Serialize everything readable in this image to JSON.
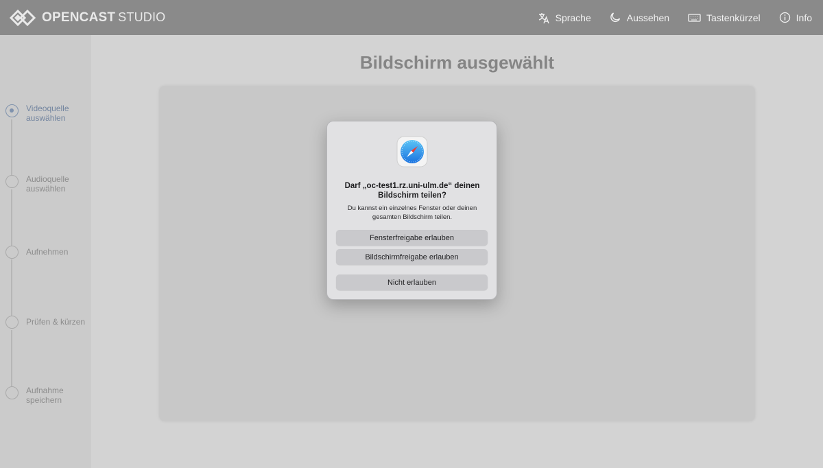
{
  "header": {
    "logo_bold": "OPENCAST",
    "logo_light": "STUDIO",
    "nav": {
      "language": "Sprache",
      "appearance": "Aussehen",
      "shortcuts": "Tastenkürzel",
      "info": "Info"
    }
  },
  "sidebar": {
    "steps": [
      {
        "label": "Videoquelle auswählen",
        "active": true
      },
      {
        "label": "Audioquelle auswählen",
        "active": false
      },
      {
        "label": "Aufnehmen",
        "active": false
      },
      {
        "label": "Prüfen & kürzen",
        "active": false
      },
      {
        "label": "Aufnahme speichern",
        "active": false
      }
    ]
  },
  "main": {
    "title": "Bildschirm ausgewählt"
  },
  "dialog": {
    "title": "Darf „oc-test1.rz.uni-ulm.de“ deinen Bildschirm teilen?",
    "message": "Du kannst ein einzelnes Fenster oder deinen gesamten Bildschirm teilen.",
    "buttons": {
      "window": "Fensterfreigabe erlauben",
      "screen": "Bildschirmfreigabe erlauben",
      "deny": "Nicht erlauben"
    },
    "app_icon": "safari-compass-icon"
  },
  "colors": {
    "header_bg": "#8a8a8a",
    "active_step": "#7f92ad",
    "dialog_bg": "#e1e1e3"
  }
}
